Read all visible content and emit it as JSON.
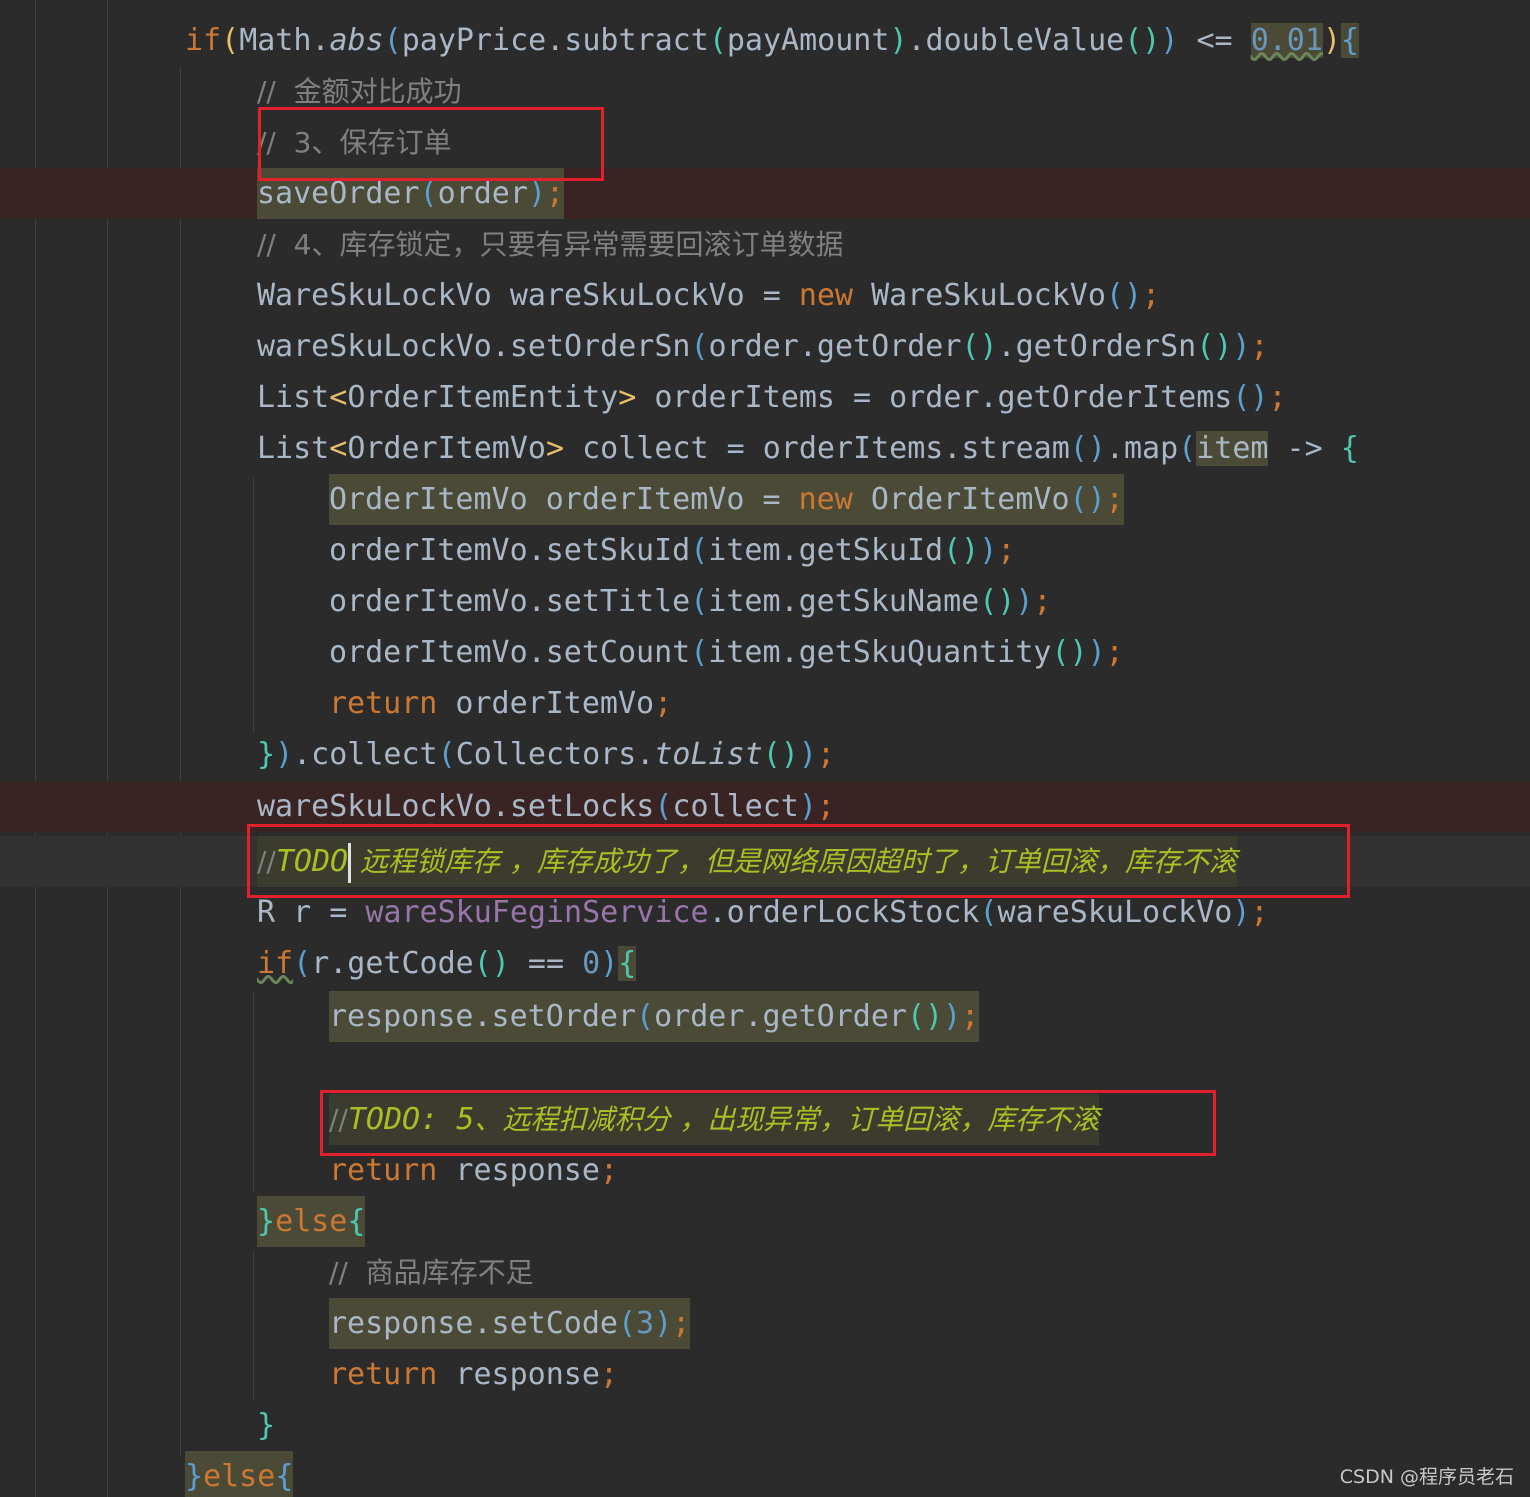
{
  "code_lines": {
    "l0": {
      "kw_if": "if",
      "open": "(",
      "math": "Math",
      "dot": ".",
      "abs": "abs",
      "p": "(",
      "a": "payPrice",
      "b": ".subtract",
      "c": "(",
      "d": "payAmount",
      "e": ")",
      "f": ".doubleValue",
      "g": "()",
      "h": ")",
      "op": " <= ",
      "num": "0.01",
      "close": ")",
      "brace": "{"
    },
    "l1": {
      "comment": "//  金额对比成功"
    },
    "l2": {
      "comment": "//  3、保存订单"
    },
    "l3": {
      "fn": "saveOrder",
      "p": "(",
      "arg": "order",
      "pc": ")",
      "semi": ";"
    },
    "l4": {
      "comment": "//  4、库存锁定，只要有异常需要回滚订单数据"
    },
    "l5": {
      "a": "WareSkuLockVo wareSkuLockVo = ",
      "kw": "new",
      "b": " WareSkuLockVo",
      "p": "()",
      "semi": ";"
    },
    "l6": {
      "a": "wareSkuLockVo.setOrderSn",
      "p1": "(",
      "b": "order.getOrder",
      "p2": "()",
      "c": ".getOrderSn",
      "p3": "()",
      "p4": ")",
      "semi": ";"
    },
    "l7": {
      "a": "List",
      "lt": "<",
      "b": "OrderItemEntity",
      "gt": ">",
      "c": " orderItems = order.getOrderItems",
      "p": "()",
      "semi": ";"
    },
    "l8": {
      "a": "List",
      "lt": "<",
      "b": "OrderItemVo",
      "gt": ">",
      "c": " collect = orderItems.stream",
      "p": "()",
      "d": ".map",
      "p1": "(",
      "item": "item",
      "arrow": " -> ",
      "brace": "{"
    },
    "l9": {
      "a": "OrderItemVo orderItemVo = ",
      "kw": "new",
      "b": " OrderItemVo",
      "p": "()",
      "semi": ";"
    },
    "l10": {
      "a": "orderItemVo.setSkuId",
      "p1": "(",
      "b": "item.getSkuId",
      "p2": "()",
      "p3": ")",
      "semi": ";"
    },
    "l11": {
      "a": "orderItemVo.setTitle",
      "p1": "(",
      "b": "item.getSkuName",
      "p2": "()",
      "p3": ")",
      "semi": ";"
    },
    "l12": {
      "a": "orderItemVo.setCount",
      "p1": "(",
      "b": "item.getSkuQuantity",
      "p2": "()",
      "p3": ")",
      "semi": ";"
    },
    "l13": {
      "kw": "return",
      "a": " orderItemVo",
      "semi": ";"
    },
    "l14": {
      "brace": "}",
      "p": ")",
      "a": ".collect",
      "p1": "(",
      "b": "Collectors.",
      "c": "toList",
      "p2": "()",
      "p3": ")",
      "semi": ";"
    },
    "l15": {
      "a": "wareSkuLockVo.setLocks",
      "p1": "(",
      "b": "collect",
      "p2": ")",
      "semi": ";"
    },
    "l16": {
      "slash": "//",
      "todo": "TODO",
      "text": " 远程锁库存 ，库存成功了，但是网络原因超时了，订单回滚，库存不滚"
    },
    "l17": {
      "a": "R r = ",
      "field": "wareSkuFeginService",
      "b": ".orderLockStock",
      "p1": "(",
      "c": "wareSkuLockVo",
      "p2": ")",
      "semi": ";"
    },
    "l18": {
      "kw": "if",
      "p1": "(",
      "a": "r.getCode",
      "p2": "()",
      "b": " == ",
      "num": "0",
      "p3": ")",
      "brace": "{"
    },
    "l19": {
      "a": "response.setOrder",
      "p1": "(",
      "b": "order.getOrder",
      "p2": "()",
      "p3": ")",
      "semi": ";"
    },
    "l21": {
      "slash": "//",
      "todo": "TODO: 5",
      "text": "、远程扣减积分 ，出现异常，订单回滚，库存不滚"
    },
    "l22": {
      "kw": "return",
      "a": " response",
      "semi": ";"
    },
    "l23": {
      "brace": "}",
      "kw": "else",
      "brace2": "{"
    },
    "l24": {
      "comment": "//  商品库存不足"
    },
    "l25": {
      "a": "response.setCode",
      "p1": "(",
      "num": "3",
      "p2": ")",
      "semi": ";"
    },
    "l26": {
      "kw": "return",
      "a": " response",
      "semi": ";"
    },
    "l27": {
      "brace": "}"
    },
    "l28": {
      "brace": "}",
      "kw": "else",
      "brace2": "{"
    }
  },
  "watermark": "CSDN @程序员老石",
  "colors": {
    "background": "#2b2b2b",
    "keyword": "#cc7832",
    "comment": "#808080",
    "todo": "#a8c023",
    "number": "#6897bb",
    "field": "#9876aa",
    "annotation_box": "#e0202a"
  }
}
